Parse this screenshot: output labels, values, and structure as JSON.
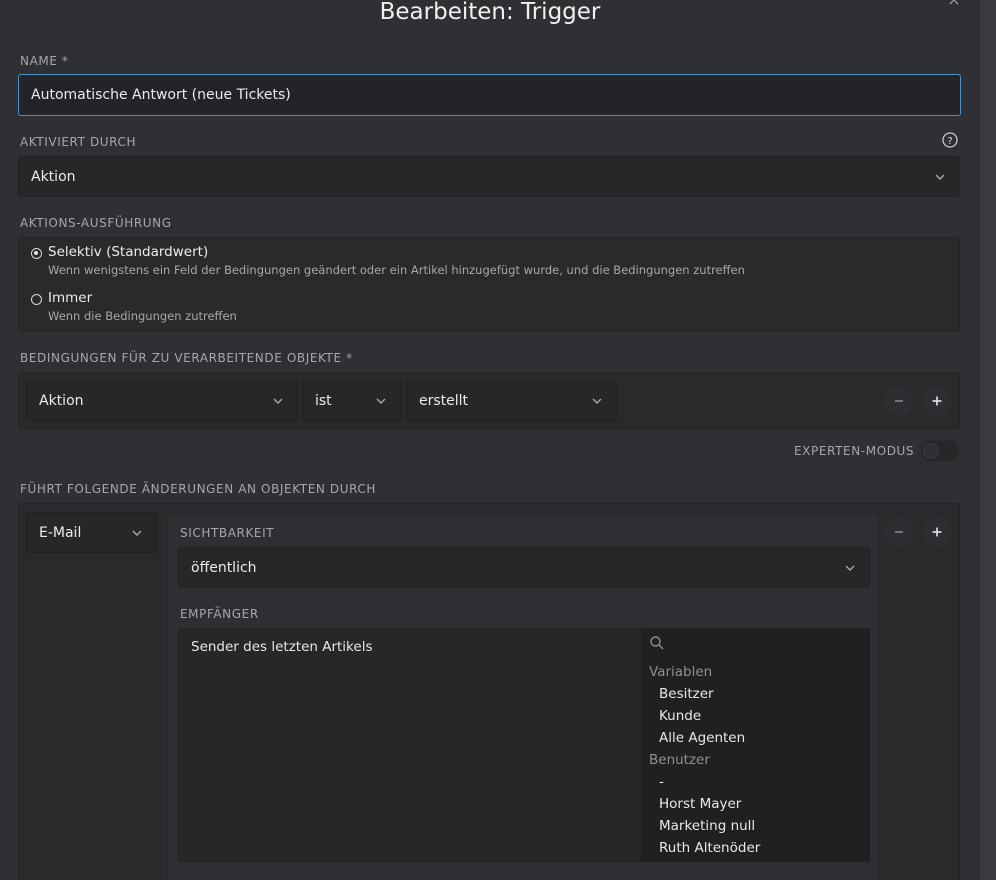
{
  "modal": {
    "title": "Bearbeiten: Trigger",
    "close_glyph": "×"
  },
  "name": {
    "label": "NAME *",
    "value": "Automatische Antwort (neue Tickets)"
  },
  "activated_by": {
    "label": "AKTIVIERT DURCH",
    "value": "Aktion",
    "help_icon": "question-circle-icon"
  },
  "execution": {
    "label": "AKTIONS-AUSFÜHRUNG",
    "options": [
      {
        "title": "Selektiv (Standardwert)",
        "description": "Wenn wenigstens ein Feld der Bedingungen geändert oder ein Artikel hinzugefügt wurde, und die Bedingungen zutreffen",
        "checked": true
      },
      {
        "title": "Immer",
        "description": "Wenn die Bedingungen zutreffen",
        "checked": false
      }
    ]
  },
  "conditions": {
    "label": "BEDINGUNGEN FÜR ZU VERARBEITENDE OBJEKTE *",
    "attribute": "Aktion",
    "operator": "ist",
    "value": "erstellt"
  },
  "expert_mode": {
    "label": "EXPERTEN-MODUS",
    "enabled": false
  },
  "changes": {
    "label": "FÜHRT FOLGENDE ÄNDERUNGEN AN OBJEKTEN DURCH",
    "type": "E-Mail",
    "visibility": {
      "label": "SICHTBARKEIT",
      "value": "öffentlich"
    },
    "recipients": {
      "label": "EMPFÄNGER",
      "selected": "Sender des letzten Artikels",
      "search_placeholder": "",
      "groups": [
        {
          "name": "Variablen",
          "items": [
            "Besitzer",
            "Kunde",
            "Alle Agenten"
          ]
        },
        {
          "name": "Benutzer",
          "items": [
            "-",
            "Horst Mayer",
            "Marketing null",
            "Ruth Altenöder"
          ]
        }
      ]
    }
  },
  "colors": {
    "accent": "#4a90c8",
    "background": "#2f3033",
    "field": "#262729"
  }
}
